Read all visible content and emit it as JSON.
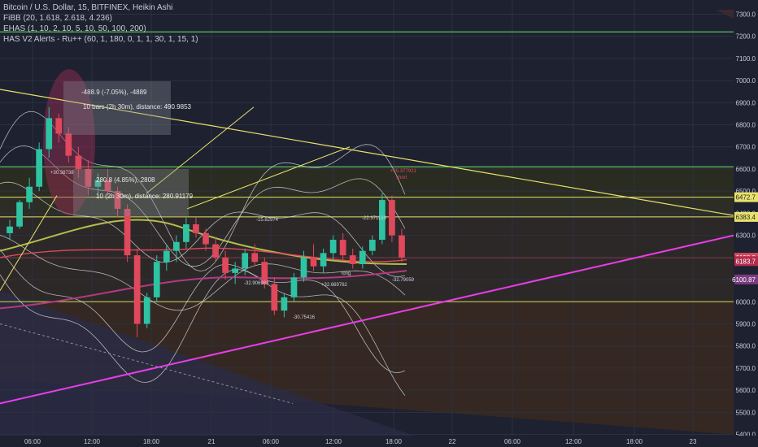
{
  "legend": {
    "line1": "Bitcoin / U.S. Dollar, 15, BITFINEX, Heikin Ashi",
    "line2": "FiBB (20, 1.618, 2.618, 4.236)",
    "line3": "EHAS (1, 10, 2, 10, 5, 10, 50, 100, 200)",
    "line4": "HAS V2 Alerts - Ru++ (60, 1, 180, 0, 1, 1, 30, 1, 15, 1)"
  },
  "price_axis": {
    "ticks": [
      "7300.0",
      "7200.0",
      "7100.0",
      "7000.0",
      "6900.0",
      "6800.0",
      "6700.0",
      "6600.0",
      "6500.0",
      "6400.0",
      "6300.0",
      "6200.0",
      "6100.0",
      "6000.0",
      "5900.0",
      "5800.0",
      "5700.0",
      "5600.0",
      "5500.0",
      "5400.0"
    ],
    "tags": [
      {
        "text": "6472.7",
        "color": "#1e2130",
        "bg": "#e8e26a"
      },
      {
        "text": "6383.4",
        "color": "#1e2130",
        "bg": "#e8e26a"
      },
      {
        "text": "6198.9",
        "color": "#ffffff",
        "bg": "#d9485f"
      },
      {
        "text": "6183.7",
        "color": "#ffffff",
        "bg": "#b22d4d"
      },
      {
        "text": "6100.87",
        "color": "#ffffff",
        "bg": "#7a3b7f"
      }
    ]
  },
  "time_axis": {
    "ticks": [
      "06:00",
      "12:00",
      "18:00",
      "21",
      "06:00",
      "12:00",
      "18:00",
      "22",
      "06:00",
      "12:00",
      "18:00",
      "23"
    ]
  },
  "measure_boxes": [
    {
      "line1": "-488.9 (-7.05%), -4889",
      "line2": "10 bars (2h 30m), distance: 490.9853"
    },
    {
      "line1": "280.8 (4.85%), 2808",
      "line2": "10 (2h 30m), distance: 280.91179"
    }
  ],
  "annotations": [
    {
      "text": "+25.377921",
      "color": "#e0485c"
    },
    {
      "text": "short",
      "color": "#e0485c"
    },
    {
      "text": "-32.79059",
      "color": "#cfd3e0"
    },
    {
      "text": "-22.371189",
      "color": "#cfd3e0"
    },
    {
      "text": "+32.669762",
      "color": "#cfd3e0"
    },
    {
      "text": "-30.75416",
      "color": "#cfd3e0"
    },
    {
      "text": "-32.906983",
      "color": "#cfd3e0"
    },
    {
      "text": "-15.82974",
      "color": "#cfd3e0"
    },
    {
      "text": "+30.38738",
      "color": "#cfd3e0"
    },
    {
      "text": "long",
      "color": "#cfd3e0"
    }
  ],
  "colors": {
    "background": "#1e2130",
    "upper_zone": "#2b2d2c",
    "lower_zone": "#2f2a1f",
    "green_line": "#5bbf5b",
    "yellow_line": "#e8e26a",
    "magenta_line": "#e83ee8",
    "candle_up": "#2ec4a3",
    "candle_down": "#e0485c",
    "envelope": "#e3e3e3",
    "grid": "#2c3040",
    "axis_text": "#c9ccd6"
  },
  "chart_data": {
    "type": "candlestick",
    "y_range": [
      5380,
      7320
    ],
    "horizontal_levels": [
      7220,
      6610,
      6472.7,
      6383.4,
      6000
    ],
    "candles": [
      [
        6310,
        6370,
        6280,
        6340
      ],
      [
        6340,
        6460,
        6330,
        6450
      ],
      [
        6450,
        6560,
        6420,
        6520
      ],
      [
        6520,
        6720,
        6500,
        6690
      ],
      [
        6690,
        6880,
        6650,
        6830
      ],
      [
        6830,
        6850,
        6720,
        6760
      ],
      [
        6760,
        6790,
        6630,
        6660
      ],
      [
        6660,
        6700,
        6560,
        6600
      ],
      [
        6600,
        6640,
        6480,
        6520
      ],
      [
        6520,
        6580,
        6470,
        6550
      ],
      [
        6550,
        6600,
        6480,
        6500
      ],
      [
        6500,
        6520,
        6380,
        6420
      ],
      [
        6420,
        6440,
        6180,
        6210
      ],
      [
        6210,
        6240,
        5840,
        5900
      ],
      [
        5900,
        6040,
        5880,
        6020
      ],
      [
        6020,
        6210,
        6000,
        6180
      ],
      [
        6180,
        6260,
        6140,
        6230
      ],
      [
        6230,
        6300,
        6180,
        6270
      ],
      [
        6270,
        6380,
        6240,
        6350
      ],
      [
        6350,
        6380,
        6290,
        6310
      ],
      [
        6310,
        6330,
        6230,
        6260
      ],
      [
        6260,
        6290,
        6180,
        6200
      ],
      [
        6200,
        6230,
        6100,
        6130
      ],
      [
        6130,
        6180,
        6080,
        6150
      ],
      [
        6150,
        6240,
        6120,
        6220
      ],
      [
        6220,
        6260,
        6160,
        6180
      ],
      [
        6180,
        6200,
        6060,
        6080
      ],
      [
        6080,
        6110,
        5940,
        5960
      ],
      [
        5960,
        6040,
        5930,
        6020
      ],
      [
        6020,
        6130,
        6000,
        6110
      ],
      [
        6110,
        6230,
        6090,
        6200
      ],
      [
        6200,
        6260,
        6140,
        6160
      ],
      [
        6160,
        6240,
        6130,
        6220
      ],
      [
        6220,
        6300,
        6190,
        6280
      ],
      [
        6280,
        6310,
        6190,
        6210
      ],
      [
        6210,
        6240,
        6150,
        6170
      ],
      [
        6170,
        6250,
        6150,
        6230
      ],
      [
        6230,
        6300,
        6210,
        6280
      ],
      [
        6280,
        6490,
        6260,
        6460
      ],
      [
        6460,
        6480,
        6270,
        6300
      ],
      [
        6300,
        6330,
        6180,
        6200
      ]
    ]
  }
}
